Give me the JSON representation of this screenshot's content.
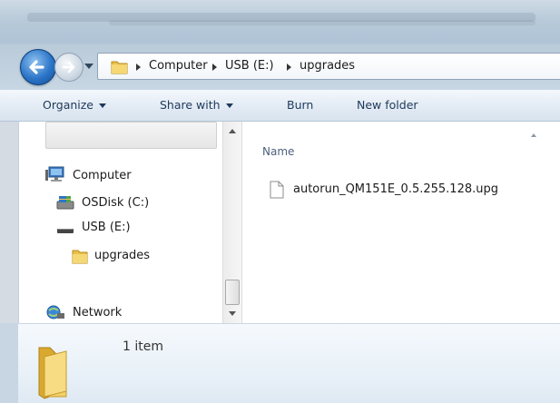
{
  "address": {
    "crumbs": [
      "Computer",
      "USB (E:)",
      "upgrades"
    ]
  },
  "toolbar": {
    "organize": "Organize",
    "share_with": "Share with",
    "burn": "Burn",
    "new_folder": "New folder"
  },
  "nav_pane": {
    "computer": "Computer",
    "osdisk": "OSDisk (C:)",
    "usb": "USB (E:)",
    "upgrades": "upgrades",
    "network": "Network"
  },
  "content": {
    "column_name": "Name",
    "files": [
      {
        "name": "autorun_QM151E_0.5.255.128.upg",
        "icon": "document-icon"
      }
    ]
  },
  "details": {
    "item_count": "1 item"
  },
  "colors": {
    "accent": "#2b74c7",
    "toolbar_text": "#1e395b",
    "folder": "#e8c04a"
  }
}
